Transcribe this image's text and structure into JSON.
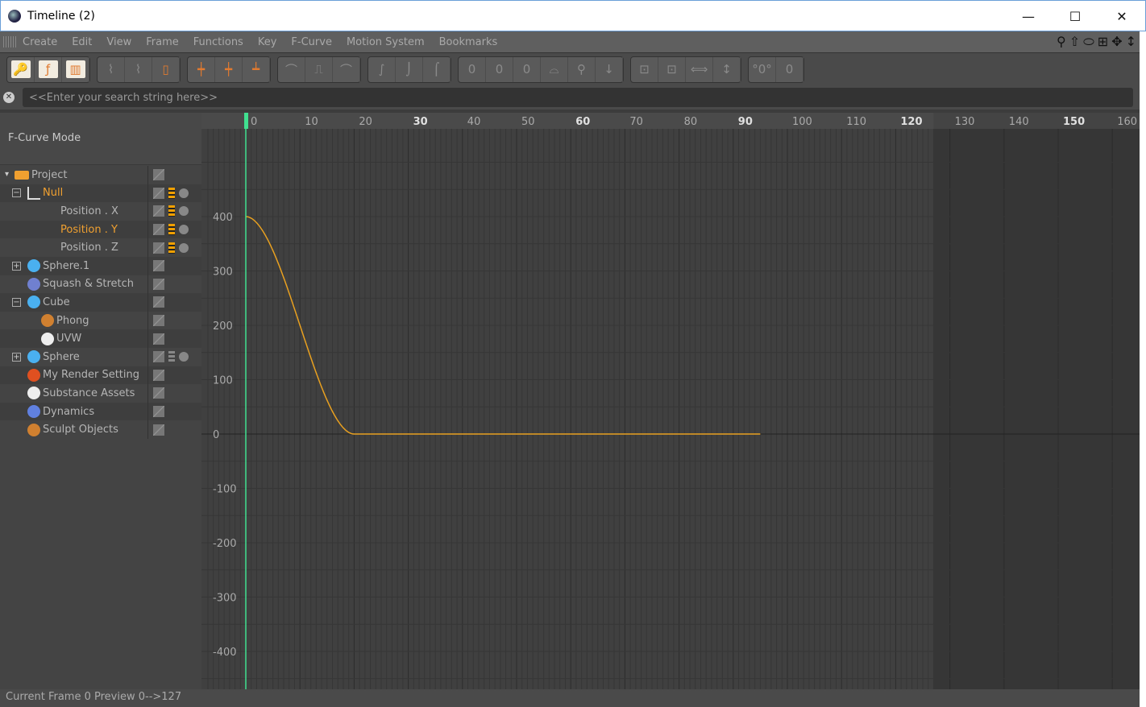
{
  "window": {
    "title": "Timeline (2)",
    "minimize": "—",
    "maximize": "☐",
    "close": "✕"
  },
  "menu": [
    "Create",
    "Edit",
    "View",
    "Frame",
    "Functions",
    "Key",
    "F-Curve",
    "Motion System",
    "Bookmarks"
  ],
  "nav_icons": [
    "search-icon",
    "home-icon",
    "zoom-icon",
    "fit-icon",
    "move-icon",
    "scale-icon"
  ],
  "toolbar_groups": [
    [
      {
        "icon": "key-mode-icon",
        "glyph": "🔑",
        "active": true
      },
      {
        "icon": "fcurve-mode-icon",
        "glyph": "ƒ",
        "active": true
      },
      {
        "icon": "dopesheet-icon",
        "glyph": "▥",
        "active": true
      }
    ],
    [
      {
        "icon": "frame-all-icon",
        "glyph": "⌇"
      },
      {
        "icon": "frame-selected-icon",
        "glyph": "⌇"
      },
      {
        "icon": "frame-range-icon",
        "glyph": "▯",
        "orange": true
      }
    ],
    [
      {
        "icon": "add-key-icon",
        "glyph": "┿",
        "orange": true
      },
      {
        "icon": "add-keys-icon",
        "glyph": "┿",
        "orange": true
      },
      {
        "icon": "delete-key-icon",
        "glyph": "┷",
        "orange": true
      }
    ],
    [
      {
        "icon": "spline-icon",
        "glyph": "⌒"
      },
      {
        "icon": "step-icon",
        "glyph": "⎍"
      },
      {
        "icon": "ease-icon",
        "glyph": "⌒"
      }
    ],
    [
      {
        "icon": "linear-icon",
        "glyph": "∫"
      },
      {
        "icon": "ease-in-icon",
        "glyph": "⌡"
      },
      {
        "icon": "ease-out-icon",
        "glyph": "⌠"
      }
    ],
    [
      {
        "icon": "tangent-1-icon",
        "glyph": "0"
      },
      {
        "icon": "tangent-2-icon",
        "glyph": "0"
      },
      {
        "icon": "tangent-3-icon",
        "glyph": "0"
      },
      {
        "icon": "tangent-4-icon",
        "glyph": "⌓"
      },
      {
        "icon": "tangent-5-icon",
        "glyph": "⚲"
      },
      {
        "icon": "tangent-6-icon",
        "glyph": "↓"
      }
    ],
    [
      {
        "icon": "lock-1-icon",
        "glyph": "⊡"
      },
      {
        "icon": "lock-2-icon",
        "glyph": "⊡"
      },
      {
        "icon": "lock-time-icon",
        "glyph": "⟺"
      },
      {
        "icon": "lock-value-icon",
        "glyph": "↕"
      }
    ],
    [
      {
        "icon": "zero-angle-icon",
        "glyph": "°0°"
      },
      {
        "icon": "zero-length-icon",
        "glyph": "0"
      }
    ]
  ],
  "search": {
    "placeholder": "<<Enter your search string here>>",
    "value": ""
  },
  "mode_label": "F-Curve Mode",
  "tree": [
    {
      "label": "Project",
      "icon": "folder-icon",
      "color": "#f0a030",
      "indent": 0,
      "expander": "▾"
    },
    {
      "label": "Null",
      "icon": "null-icon",
      "color": "#ddd",
      "indent": 1,
      "expander": "−",
      "selected": true,
      "keys": true
    },
    {
      "label": "Position . X",
      "indent": 3,
      "keys": true
    },
    {
      "label": "Position . Y",
      "indent": 3,
      "keys": true,
      "selected": true
    },
    {
      "label": "Position . Z",
      "indent": 3,
      "keys": true
    },
    {
      "label": "Sphere.1",
      "icon": "sphere-icon",
      "color": "#4ab0f0",
      "indent": 1,
      "expander": "+"
    },
    {
      "label": "Squash & Stretch",
      "icon": "deformer-icon",
      "color": "#7080d0",
      "indent": 1
    },
    {
      "label": "Cube",
      "icon": "cube-icon",
      "color": "#4ab0f0",
      "indent": 1,
      "expander": "−"
    },
    {
      "label": "Phong",
      "icon": "phong-tag-icon",
      "color": "#d08030",
      "indent": 2
    },
    {
      "label": "UVW",
      "icon": "uvw-tag-icon",
      "color": "#eee",
      "indent": 2
    },
    {
      "label": "Sphere",
      "icon": "sphere-icon",
      "color": "#4ab0f0",
      "indent": 1,
      "expander": "+",
      "keys_gray": true
    },
    {
      "label": "My Render Setting",
      "icon": "render-settings-icon",
      "color": "#e05020",
      "indent": 1
    },
    {
      "label": "Substance Assets",
      "icon": "substance-icon",
      "color": "#eee",
      "indent": 1
    },
    {
      "label": "Dynamics",
      "icon": "dynamics-icon",
      "color": "#6080e0",
      "indent": 1
    },
    {
      "label": "Sculpt Objects",
      "icon": "sculpt-icon",
      "color": "#d08030",
      "indent": 1
    }
  ],
  "chart_data": {
    "type": "line",
    "xlim": [
      -8,
      165
    ],
    "ylim": [
      -470,
      530
    ],
    "x_ticks": [
      0,
      10,
      20,
      30,
      40,
      50,
      60,
      70,
      80,
      90,
      100,
      110,
      120,
      130,
      140,
      150,
      160
    ],
    "y_ticks": [
      400,
      300,
      200,
      100,
      0,
      -100,
      -200,
      -300,
      -400
    ],
    "preview_end": 127,
    "current_frame": 0,
    "series": [
      {
        "color": "#e8a020",
        "points": [
          [
            0,
            400
          ],
          [
            20,
            0
          ],
          [
            95,
            0
          ]
        ],
        "interpolation": "ease"
      }
    ],
    "grid": true
  },
  "colors": {
    "accent": "#f0a030",
    "playhead": "#40e090",
    "curve": "#e8a020"
  },
  "status": "Current Frame  0  Preview  0-->127"
}
